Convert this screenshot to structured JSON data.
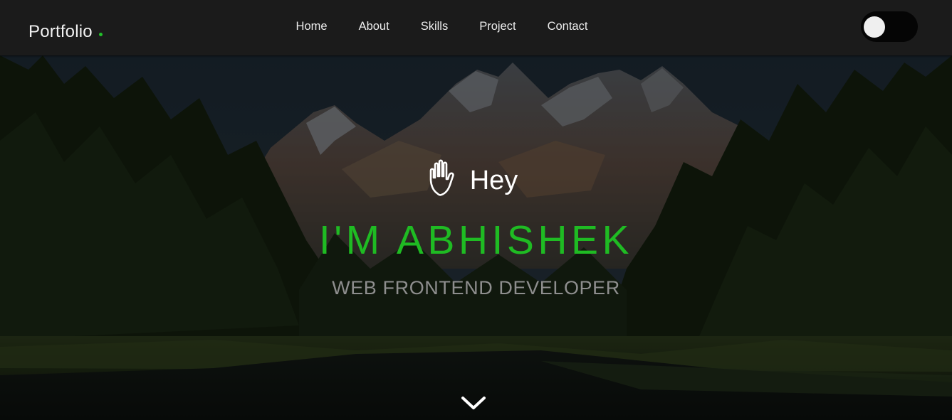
{
  "navbar": {
    "brand": "Portfolio",
    "brand_dot_color": "#22c22a",
    "links": [
      {
        "label": "Home"
      },
      {
        "label": "About"
      },
      {
        "label": "Skills"
      },
      {
        "label": "Project"
      },
      {
        "label": "Contact"
      }
    ],
    "theme_toggle": {
      "state": "off",
      "icon": "toggle-switch"
    }
  },
  "hero": {
    "greeting_icon": "waving-hand-icon",
    "greeting": "Hey",
    "name": "I'M ABHISHEK",
    "role": "WEB FRONTEND DEVELOPER",
    "scroll_icon": "chevron-down-icon",
    "accent_color": "#1fbb23",
    "background": "mountain-forest-lake-photo"
  }
}
